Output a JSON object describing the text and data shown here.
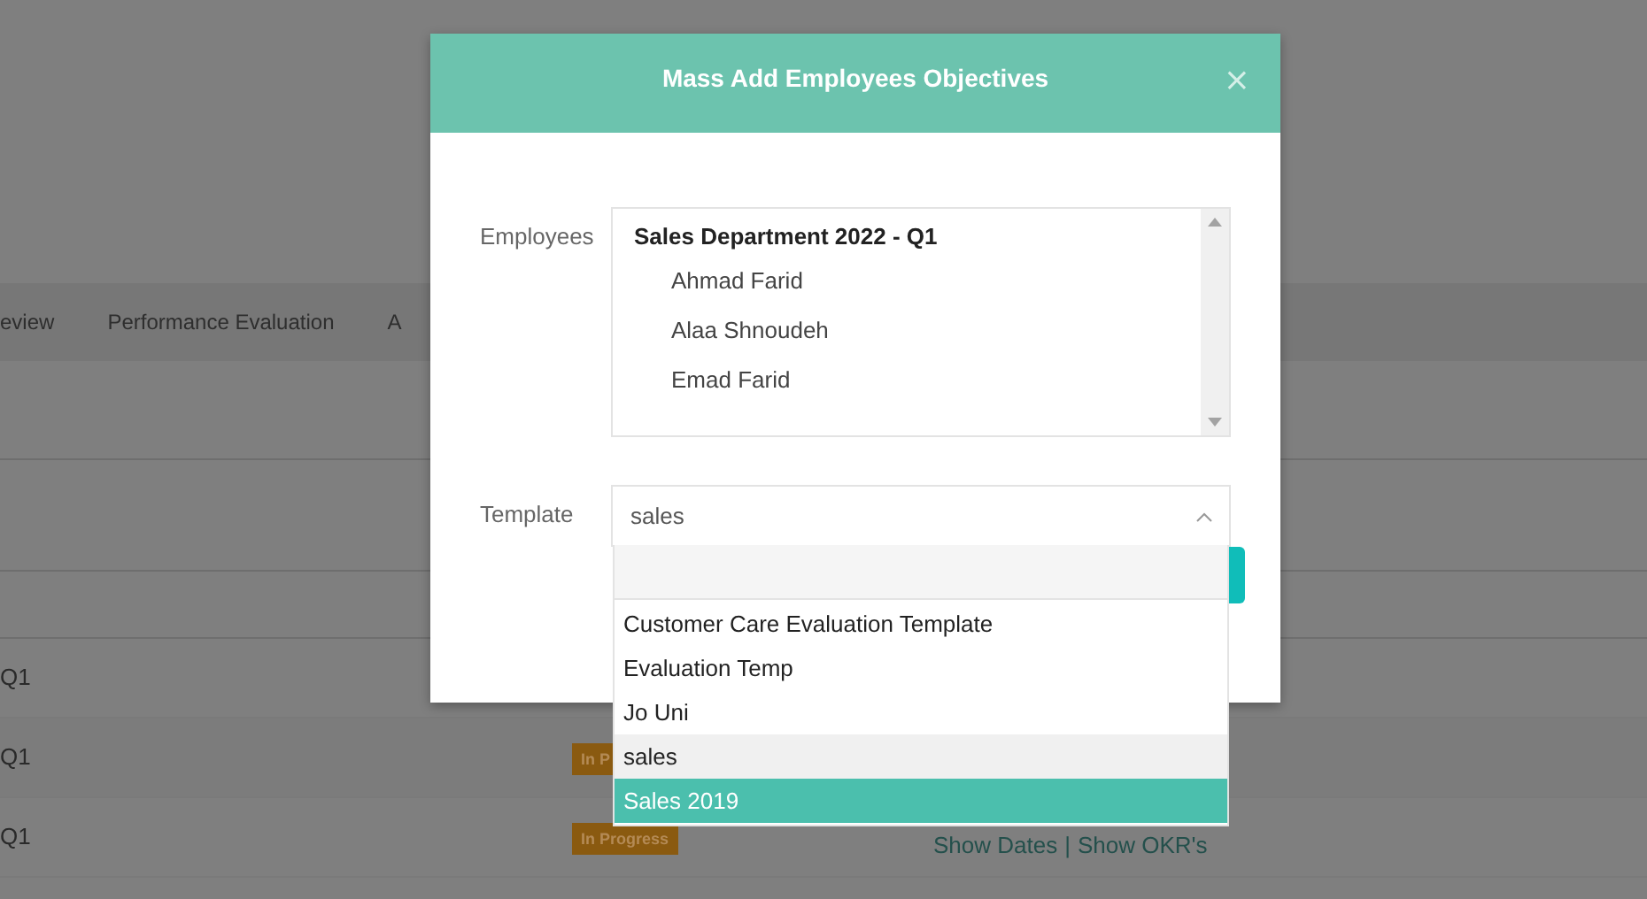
{
  "background": {
    "tabs": [
      {
        "label": "eview"
      },
      {
        "label": "Performance Evaluation"
      },
      {
        "label": "A"
      }
    ],
    "rows": [
      {
        "period": "Q1"
      },
      {
        "period": "Q1",
        "status": "In P"
      },
      {
        "period": "Q1",
        "status": "In Progress",
        "actions": [
          "Show Dates",
          "Show OKR's"
        ],
        "separator": "|"
      }
    ]
  },
  "dialog": {
    "title": "Mass Add Employees Objectives",
    "close": "×",
    "employees": {
      "label": "Employees",
      "groups": [
        {
          "name": "Sales Department 2022 - Q1",
          "options": [
            "Ahmad Farid",
            "Alaa Shnoudeh",
            "Emad Farid"
          ]
        }
      ]
    },
    "template": {
      "label": "Template",
      "value": "sales",
      "expanded": true,
      "options": [
        {
          "label": "Customer Care Evaluation Template",
          "highlighted": false,
          "selected": false
        },
        {
          "label": "Evaluation Temp",
          "highlighted": false,
          "selected": false
        },
        {
          "label": "Jo Uni",
          "highlighted": false,
          "selected": false
        },
        {
          "label": "sales",
          "highlighted": false,
          "selected": true
        },
        {
          "label": "Sales 2019",
          "highlighted": true,
          "selected": false
        }
      ]
    }
  }
}
